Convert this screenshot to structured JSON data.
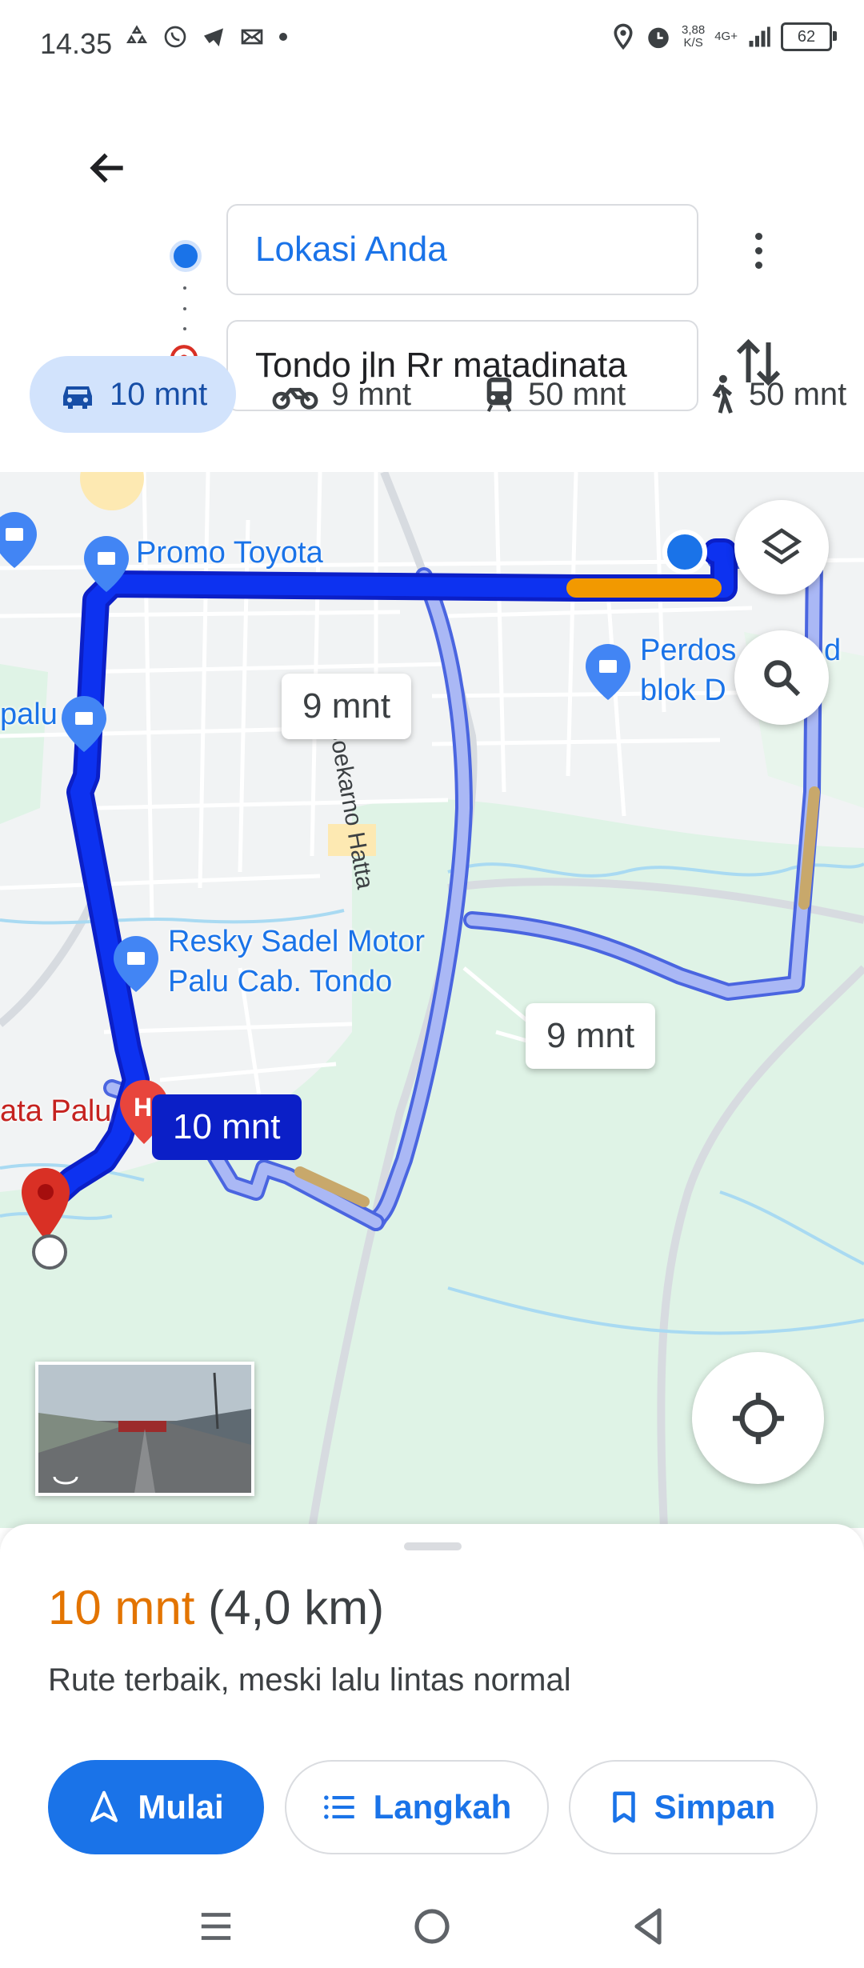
{
  "status_bar": {
    "time": "14.35",
    "speed_value": "3,88",
    "speed_unit": "K/S",
    "network": "4G+",
    "battery": "62"
  },
  "directions": {
    "origin": "Lokasi Anda",
    "destination": "Tondo jln Rr matadinata"
  },
  "modes": [
    {
      "label": "10 mnt",
      "icon": "car-icon",
      "active": true
    },
    {
      "label": "9 mnt",
      "icon": "motorcycle-icon",
      "active": false
    },
    {
      "label": "50 mnt",
      "icon": "transit-icon",
      "active": false
    },
    {
      "label": "50 mnt",
      "icon": "walk-icon",
      "active": false
    }
  ],
  "map": {
    "labels": {
      "promo_toyota": "Promo Toyota",
      "perdos_1": "Perdos",
      "perdos_2": "d",
      "blok_d": "blok D",
      "palu_left": "palu",
      "resky_1": "Resky Sadel Motor",
      "resky_2": "Palu Cab. Tondo",
      "hospital": "ata Palu",
      "road_soekarno": "Jl. Soekarno Hatta"
    },
    "route_bubbles": {
      "alt_1": "9 mnt",
      "alt_2": "9 mnt",
      "selected": "10 mnt"
    },
    "colors": {
      "primary_route": "#0b1fe0",
      "alt_route": "#aab8f5",
      "traffic_orange": "#f29900",
      "traffic_tan": "#c8a86b"
    }
  },
  "sheet": {
    "time": "10 mnt",
    "distance": "(4,0 km)",
    "description": "Rute terbaik, meski lalu lintas normal",
    "start_label": "Mulai",
    "steps_label": "Langkah",
    "save_label": "Simpan"
  }
}
